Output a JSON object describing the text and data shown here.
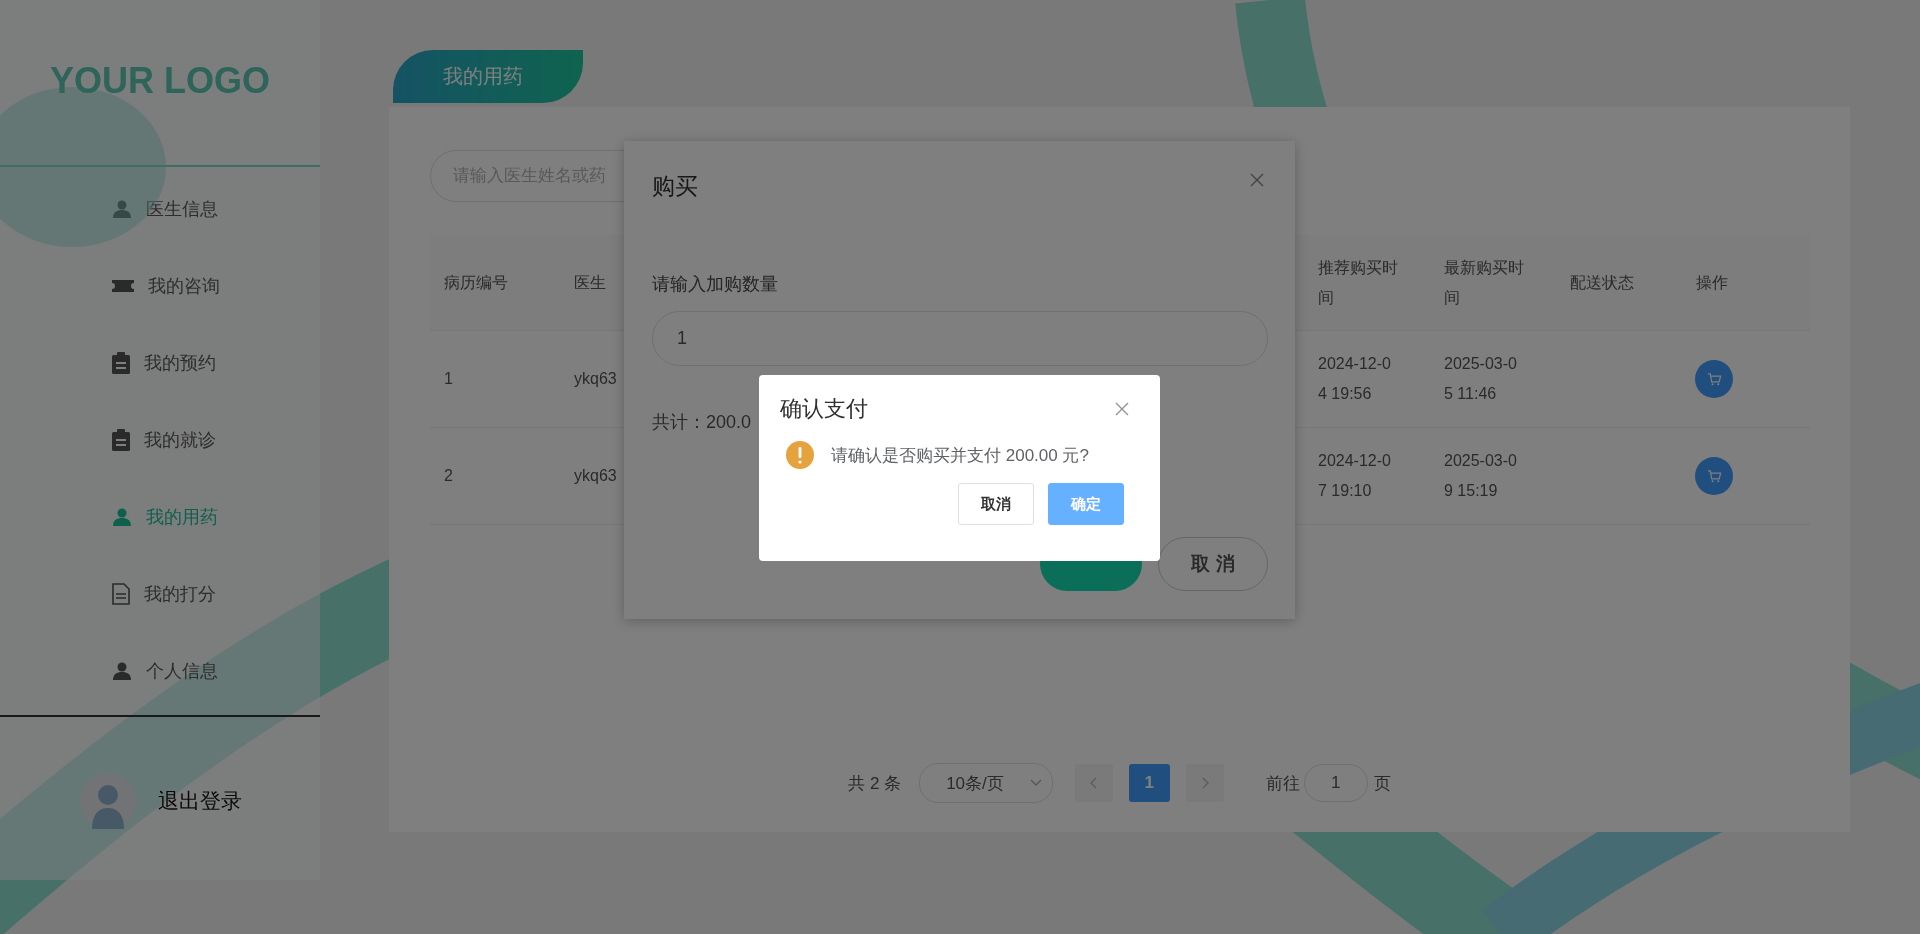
{
  "sidebar": {
    "logo": "YOUR LOGO",
    "items": [
      {
        "label": "医生信息",
        "kind": "person",
        "selected": false
      },
      {
        "label": "我的咨询",
        "kind": "ticket",
        "selected": false
      },
      {
        "label": "我的预约",
        "kind": "clipboard",
        "selected": false
      },
      {
        "label": "我的就诊",
        "kind": "clipboard",
        "selected": false
      },
      {
        "label": "我的用药",
        "kind": "person",
        "selected": true
      },
      {
        "label": "我的打分",
        "kind": "document",
        "selected": false
      },
      {
        "label": "个人信息",
        "kind": "person",
        "selected": false
      }
    ],
    "logout": "退出登录"
  },
  "page_tab": {
    "label": "我的用药"
  },
  "search": {
    "placeholder": "请输入医生姓名或药"
  },
  "table": {
    "columns": [
      "病历编号",
      "医生",
      "推荐购买时间",
      "最新购买时间",
      "配送状态",
      "操作"
    ],
    "rows": [
      {
        "id": "1",
        "doctor": "ykq63",
        "recommended": "2024-12-04 19:56",
        "latest": "2025-03-05 11:46"
      },
      {
        "id": "2",
        "doctor": "ykq63",
        "recommended": "2024-12-07 19:10",
        "latest": "2025-03-09 15:19"
      }
    ]
  },
  "pagination": {
    "total": "共 2 条",
    "page_size": "10条/页",
    "pages": [
      {
        "label": "1",
        "selected": true
      }
    ],
    "goto_label": "前往",
    "goto_value": "1",
    "goto_suffix": "页"
  },
  "purchase_dialog": {
    "title": "购买",
    "quantity_label": "请输入加购数量",
    "quantity_value": "1",
    "total": "共计：200.0",
    "buttons": [
      {
        "kind": "primary"
      },
      {
        "label": "取 消",
        "kind": "default"
      }
    ]
  },
  "confirm_dialog": {
    "title": "确认支付",
    "message": "请确认是否购买并支付 200.00 元?",
    "buttons": [
      {
        "label": "取消",
        "kind": "default"
      },
      {
        "label": "确定",
        "kind": "primary"
      }
    ]
  }
}
